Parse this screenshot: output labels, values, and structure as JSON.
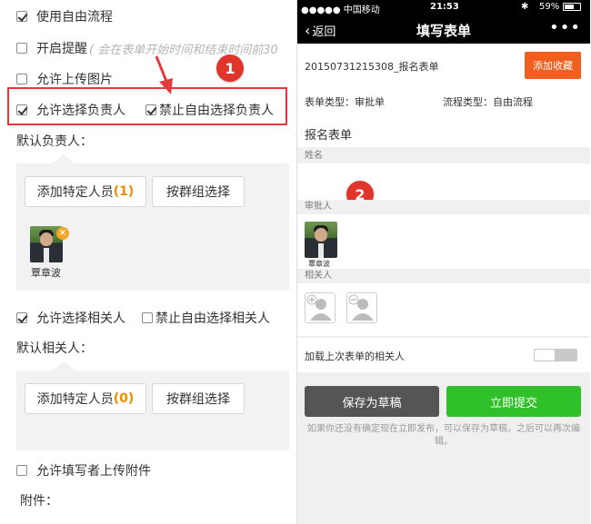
{
  "left": {
    "use_free_flow": "使用自由流程",
    "enable_reminder": "开启提醒",
    "reminder_hint": "( 会在表单开始时间和结束时间前30",
    "allow_upload_image": "允许上传图片",
    "allow_choose_owner": "允许选择负责人",
    "forbid_free_choose_owner": "禁止自由选择负责人",
    "default_owner_label": "默认负责人：",
    "add_specific_people_1": "添加特定人员",
    "add_specific_count_1": "(1)",
    "group_select_1": "按群组选择",
    "owner_name": "覃章波",
    "allow_choose_related": "允许选择相关人",
    "forbid_free_choose_related": "禁止自由选择相关人",
    "default_related_label": "默认相关人：",
    "add_specific_people_2": "添加特定人员",
    "add_specific_count_2": "(0)",
    "group_select_2": "按群组选择",
    "allow_attach": "允许填写者上传附件",
    "attach_label": "附件：",
    "badge_1": "1"
  },
  "right": {
    "status": {
      "carrier": "●●●●● 中国移动",
      "time": "21:53",
      "battery": "59%"
    },
    "nav": {
      "back": "返回",
      "title": "填写表单",
      "more": "•••"
    },
    "form_id": "20150731215308_报名表单",
    "add_fav": "添加收藏",
    "form_type_label": "表单类型：",
    "form_type_value": "审批单",
    "flow_type_label": "流程类型：",
    "flow_type_value": "自由流程",
    "form_title": "报名表单",
    "name_label": "姓名",
    "approver_label": "审批人",
    "approver_name": "覃章波",
    "related_label": "相关人",
    "load_last_related": "加载上次表单的相关人",
    "save_draft": "保存为草稿",
    "submit_now": "立即提交",
    "footnote": "如果你还没有确定现在立即发布，可以保存为草稿，之后可以再次编辑。",
    "badge_2": "2"
  },
  "colors": {
    "accent_orange": "#f25e1d",
    "submit_green": "#2fc02a",
    "highlight_red": "#e23a3a"
  }
}
